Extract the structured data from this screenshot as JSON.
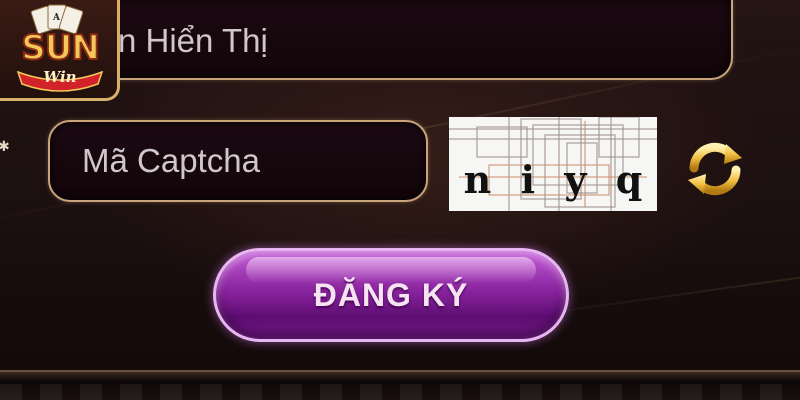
{
  "logo": {
    "brand_top": "SUN",
    "brand_bottom": "Win"
  },
  "form": {
    "display_name": {
      "placeholder": "n Hiển Thị",
      "value": ""
    },
    "captcha_field": {
      "placeholder": "Mã Captcha",
      "value": ""
    },
    "captcha_image": {
      "chars": [
        "n",
        "i",
        "y",
        "q"
      ]
    },
    "refresh_icon": "refresh-icon",
    "register_label": "ĐĂNG KÝ"
  },
  "colors": {
    "field_border": "#c9a37a",
    "button_purple": "#8a249e",
    "logo_gold": "#f3c75a",
    "logo_red": "#d2232a"
  }
}
